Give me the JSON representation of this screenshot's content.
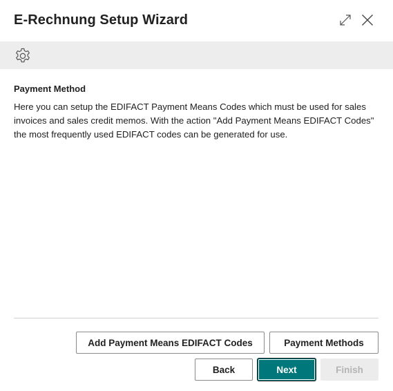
{
  "window": {
    "title": "E-Rechnung Setup Wizard"
  },
  "icons": {
    "expand": "expand-icon",
    "close": "close-icon",
    "banner": "gear-icon"
  },
  "step": {
    "title": "Payment Method",
    "description": "Here you can setup the EDIFACT Payment Means Codes which must be used for sales invoices and sales credit memos. With the action \"Add Payment Means EDIFACT Codes\" the most frequently used EDIFACT codes can be generated for use."
  },
  "actions": {
    "add_codes_label": "Add Payment Means EDIFACT Codes",
    "payment_methods_label": "Payment Methods"
  },
  "nav": {
    "back_label": "Back",
    "next_label": "Next",
    "finish_label": "Finish",
    "finish_disabled": true
  },
  "colors": {
    "accent": "#00777a",
    "banner_bg": "#ededed",
    "disabled_bg": "#ececec"
  }
}
